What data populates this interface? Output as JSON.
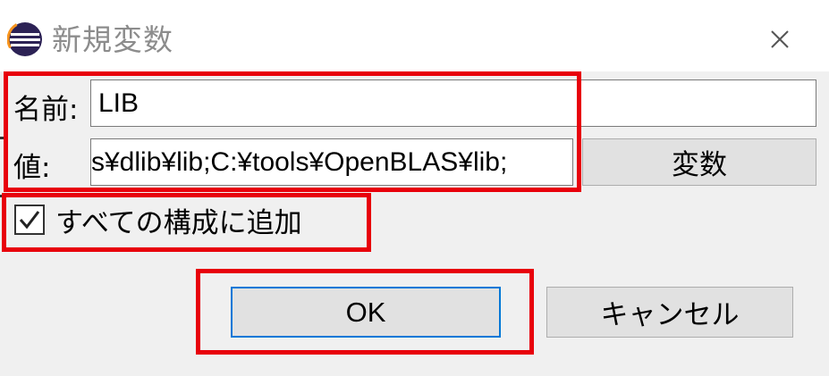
{
  "window": {
    "title": "新規変数",
    "icon": "eclipse-icon",
    "close_icon": "close-icon"
  },
  "form": {
    "name_label": "名前:",
    "name_value": "LIB",
    "value_label": "値:",
    "value_value": "s¥dlib¥lib;C:¥tools¥OpenBLAS¥lib;",
    "variables_button": "変数",
    "checkbox_label": "すべての構成に追加",
    "checkbox_checked": true
  },
  "buttons": {
    "ok": "OK",
    "cancel": "キャンセル"
  },
  "colors": {
    "highlight": "#e8000b",
    "default_button_border": "#0078d7",
    "title_text": "#8c8c8c"
  }
}
